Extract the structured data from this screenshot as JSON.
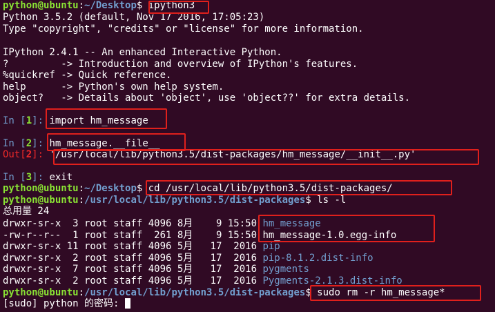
{
  "prompt": {
    "user_host": "python@ubuntu",
    "sep": ":",
    "desktop_path": "~/Desktop",
    "pkgs_path": "/usr/local/lib/python3.5/dist-packages",
    "dollar": "$ "
  },
  "cmd1": "ipython3",
  "banner": [
    "Python 3.5.2 (default, Nov 17 2016, 17:05:23)",
    "Type \"copyright\", \"credits\" or \"license\" for more information.",
    "",
    "IPython 2.4.1 -- An enhanced Interactive Python.",
    "?         -> Introduction and overview of IPython's features.",
    "%quickref -> Quick reference.",
    "help      -> Python's own help system.",
    "object?   -> Details about 'object', use 'object??' for extra details."
  ],
  "in1": {
    "prefix": "In [",
    "num": "1",
    "suffix": "]: ",
    "code": "import hm_message"
  },
  "in2": {
    "prefix": "In [",
    "num": "2",
    "suffix": "]: ",
    "code": "hm_message.__file__"
  },
  "out2": {
    "prefix": "Out[",
    "num": "2",
    "suffix": "]: ",
    "value": "'/usr/local/lib/python3.5/dist-packages/hm_message/__init__.py'"
  },
  "in3": {
    "prefix": "In [",
    "num": "3",
    "suffix": "]: ",
    "code": "exit"
  },
  "cmd_cd": "cd /usr/local/lib/python3.5/dist-packages/",
  "cmd_ls": "ls -l",
  "total": "总用量 24",
  "listing": [
    {
      "meta": "drwxr-sr-x  3 root staff 4096 8月    9 15:50 ",
      "name": "hm_message",
      "is_dir": true
    },
    {
      "meta": "-rw-r--r--  1 root staff  261 8月    9 15:50 ",
      "name": "hm_message-1.0.egg-info",
      "is_dir": false
    },
    {
      "meta": "drwxr-sr-x 11 root staff 4096 5月   17  2016 ",
      "name": "pip",
      "is_dir": true
    },
    {
      "meta": "drwxr-sr-x  2 root staff 4096 5月   17  2016 ",
      "name": "pip-8.1.2.dist-info",
      "is_dir": true
    },
    {
      "meta": "drwxr-sr-x  7 root staff 4096 5月   17  2016 ",
      "name": "pygments",
      "is_dir": true
    },
    {
      "meta": "drwxr-sr-x  2 root staff 4096 5月   17  2016 ",
      "name": "Pygments-2.1.3.dist-info",
      "is_dir": true
    }
  ],
  "cmd_rm": "sudo rm -r hm_message*",
  "sudo_prompt": "[sudo] python 的密码:",
  "colors": {
    "background": "#300a24",
    "prompt_user": "#8ae234",
    "prompt_path": "#729fcf",
    "annotation": "#e0201c",
    "out_prompt": "#ef2929"
  }
}
